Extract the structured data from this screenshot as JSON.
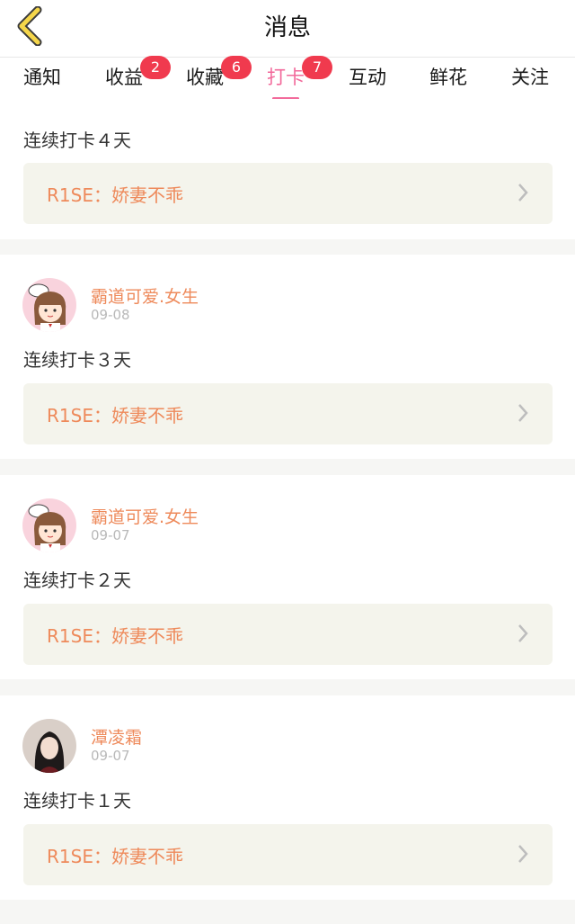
{
  "header": {
    "title": "消息"
  },
  "tabs": [
    {
      "label": "通知",
      "badge": ""
    },
    {
      "label": "收益",
      "badge": "2"
    },
    {
      "label": "收藏",
      "badge": "6"
    },
    {
      "label": "打卡",
      "badge": "7",
      "active": true
    },
    {
      "label": "互动",
      "badge": ""
    },
    {
      "label": "鲜花",
      "badge": ""
    },
    {
      "label": "关注",
      "badge": ""
    }
  ],
  "cards": [
    {
      "message": "连续打卡４天",
      "link": "R1SE：娇妻不乖"
    },
    {
      "user": "霸道可爱.女生",
      "date": "09-08",
      "message": "连续打卡３天",
      "link": "R1SE：娇妻不乖",
      "avatar_icon": "cartoon-girl-avatar"
    },
    {
      "user": "霸道可爱.女生",
      "date": "09-07",
      "message": "连续打卡２天",
      "link": "R1SE：娇妻不乖",
      "avatar_icon": "cartoon-girl-avatar"
    },
    {
      "user": "潭凌霜",
      "date": "09-07",
      "message": "连续打卡１天",
      "link": "R1SE：娇妻不乖",
      "avatar_icon": "photo-avatar"
    }
  ],
  "colors": {
    "accent": "#f26a9b",
    "badge": "#f03a4e",
    "username": "#ee8a5b",
    "back_arrow": "#f5d64a"
  }
}
